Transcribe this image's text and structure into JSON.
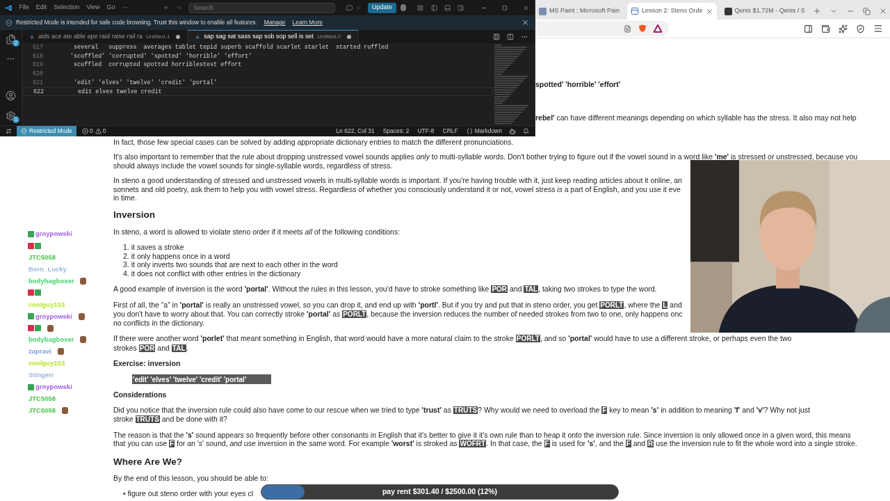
{
  "editor": {
    "menu": [
      "File",
      "Edit",
      "Selection",
      "View",
      "Go",
      "···"
    ],
    "search": {
      "placeholder": "Search"
    },
    "update_button": "Update",
    "banner": {
      "text": "Restricted Mode is intended for safe code browsing. Trust this window to enable all features.",
      "links": [
        "Manage",
        "Learn More"
      ]
    },
    "activity_badges": {
      "explorer": "2",
      "settings": "1"
    },
    "tabs": [
      {
        "label": "aids ace ate able ape raid raise rail ra",
        "file": "Untitled-1",
        "selected": false,
        "dirty": true
      },
      {
        "label": "sap sag sat sass sap sob sop sell is set",
        "file": "Untitled-2",
        "selected": true,
        "dirty": true
      }
    ],
    "lines": [
      {
        "number": "617",
        "text": "  several   suppress  averages tablet tepid superb scaffold scarlet starlet  started ruffled",
        "current": false
      },
      {
        "number": "618",
        "text": " 'scuffled' 'corrupted' 'spotted' 'horrible' 'effort'",
        "current": false
      },
      {
        "number": "619",
        "text": "  scuffled  corrupted spotted horriblestest effort",
        "current": false
      },
      {
        "number": "620",
        "current": false
      },
      {
        "number": "621",
        "text": "  'edit' 'elves' 'twelve' 'credit' 'portal'",
        "current": false
      },
      {
        "number": "622",
        "text": "   edit elves twelve credit",
        "current": true
      }
    ],
    "status_bar": {
      "mode": "Restricted Mode",
      "errors": "0",
      "warnings": "0",
      "items": [
        "Ln 622, Col 31",
        "Spaces: 2",
        "UTF-8",
        "CRLF"
      ],
      "language": "Markdown"
    }
  },
  "browser": {
    "tabs": [
      {
        "title": "MS Paint : Microsoft Pain",
        "selected": false,
        "closable": false
      },
      {
        "title": "Lesson 2: Steno Orde",
        "selected": true,
        "closable": true
      },
      {
        "title": "Qenis $1.72M - Qenis / S",
        "selected": false,
        "closable": false
      }
    ]
  },
  "article": [
    {
      "kind": "fragment",
      "bold": true,
      "lines": [
        [
          "spotted' 'horrible' 'effort'"
        ]
      ]
    },
    {
      "kind": "fragment",
      "bold": false,
      "lines": [
        [
          "**rebel'** can have different meanings depending on which syllable has the stress. It also may not help"
        ]
      ]
    },
    {
      "kind": "p",
      "lines": [
        [
          "In fact, those few special cases can be solved by adding appropriate dictionary entries to match the different pronunciations."
        ]
      ]
    },
    {
      "kind": "p",
      "lines": [
        [
          "It's also important to remember that the rule about dropping unstressed vowel sounds applies *only* to multi-syllable words. Don't bother trying to figure out if the vowel sound in a word like **'me'** is stressed or unstressed, because you"
        ],
        [
          "should always include the vowel sounds for single-syllable words, regardless of stress."
        ]
      ]
    },
    {
      "kind": "p",
      "lines": [
        [
          "In steno a good understanding of stressed and unstressed vowels in multi-syllable words is important. If you're having trouble with it, just keep reading articles about it online, an"
        ],
        [
          "sonnets and old poetry, ask them to help you with vowel stress. Regardless of whether you consciously understand it or not, vowel stress *is* a part of English, and you use it eve"
        ],
        [
          "in time."
        ]
      ]
    },
    {
      "kind": "h2",
      "text": "Inversion"
    },
    {
      "kind": "p",
      "lines": [
        [
          "In steno, a word is allowed to violate steno order if it meets *all* of the following conditions:"
        ]
      ]
    },
    {
      "kind": "list",
      "items": [
        {
          "marker": "1.",
          "text": "it saves a stroke"
        },
        {
          "marker": "2.",
          "text": "it only happens once in a word"
        },
        {
          "marker": "3.",
          "text": "it only inverts two sounds that are next to each other in the word"
        },
        {
          "marker": "4.",
          "text": "it does not conflict with other entries in the dictionary"
        }
      ]
    },
    {
      "kind": "p",
      "lines": [
        [
          "A good example of inversion is the word **'portal'**. Without the rules in this lesson, you'd have to stroke something like ",
          {
            "key": "POR"
          },
          " and ",
          {
            "key": "TAL"
          },
          ", taking two strokes to type the word."
        ]
      ]
    },
    {
      "kind": "p",
      "lines": [
        [
          "First of all, the “a” in **'portal'** is really an unstressed vowel, so you can drop it, and end up with **'portl'**. But if you try and put that in steno order, you get ",
          {
            "key": "PORLT"
          },
          ", where the ",
          {
            "key": "L"
          },
          " and"
        ],
        [
          "you don't have to worry about that. You can correctly stroke **'portal'** as ",
          {
            "key": "PORLT"
          },
          ", because the inversion reduces the number of needed strokes from two to one, only happens onc"
        ],
        [
          "no conflicts in the dictionary."
        ]
      ]
    },
    {
      "kind": "p",
      "lines": [
        [
          "If there were another word **'porlet'** that meant something in English, that word would have a more natural claim to the stroke ",
          {
            "key": "PORLT"
          },
          ", and so **'portal'** would have to use a different stroke, or perhaps even the two"
        ],
        [
          "strokes ",
          {
            "key": "POR"
          },
          " and ",
          {
            "key": "TAL"
          },
          "."
        ]
      ]
    },
    {
      "kind": "h3",
      "text": "Exercise: inversion"
    },
    {
      "kind": "field",
      "value": "'edit' 'elves' 'twelve' 'credit' 'portal'"
    },
    {
      "kind": "h3",
      "text": "Considerations"
    },
    {
      "kind": "p",
      "lines": [
        [
          "Did you notice that the inversion rule could also have come to our rescue when we tried to type **'trust'** as ",
          {
            "key": "TRUTS"
          },
          "? Why would we need to overload the ",
          {
            "key": "F"
          },
          " key to mean **'s'** in addition to meaning **'f'** and **'v'**? Why not just"
        ],
        [
          "stroke ",
          {
            "key": "TRUTS"
          },
          " and be done with it?"
        ]
      ]
    },
    {
      "kind": "p",
      "lines": [
        [
          "The reason is that the **'s'** sound appears so frequently before other consonants in English that it's better to give it it's own rule than to heap it onto the inversion rule. Since inversion is only allowed once in a given word, this means"
        ],
        [
          "that you can use ",
          {
            "key": "F"
          },
          " for an 's' sound, *and* use inversion in the same word. For example **'worst'** is stroked as ",
          {
            "key": "WOFRT"
          },
          ". In that case, the ",
          {
            "key": "F"
          },
          " is used for **'s'**, and the ",
          {
            "key": "F"
          },
          " and ",
          {
            "key": "R"
          },
          " use the inversion rule to fit the whole word into a single stroke."
        ]
      ]
    },
    {
      "kind": "h2",
      "text": "Where Are We?"
    },
    {
      "kind": "p",
      "lines": [
        [
          "By the end of this lesson, you should be able to:"
        ]
      ]
    },
    {
      "kind": "list",
      "items": [
        {
          "marker": "•",
          "text": "figure out steno order with your eyes cl"
        }
      ]
    }
  ],
  "chat": [
    {
      "name": "groypowski",
      "color": "#a35ee0",
      "badges": [
        {
          "kind": "sub"
        }
      ],
      "emote": false
    },
    {
      "badges": [
        {
          "kind": "gift"
        },
        {
          "kind": "sub"
        }
      ],
      "emote": false
    },
    {
      "name": "JTC5058",
      "color": "#45c445",
      "emote": false
    },
    {
      "name": "Born_Lucky",
      "color": "#9cb8de",
      "emote": false
    },
    {
      "name": "bodybagboxer",
      "color": "#40d46c",
      "emote": true
    },
    {
      "badges": [
        {
          "kind": "gift"
        },
        {
          "kind": "sub"
        }
      ],
      "emote": false
    },
    {
      "name": "coolguy103",
      "color": "#b4e41f",
      "emote": false
    },
    {
      "name": "groypowski",
      "color": "#a35ee0",
      "badges": [
        {
          "kind": "sub"
        }
      ],
      "emote": true
    },
    {
      "badges": [
        {
          "kind": "gift"
        },
        {
          "kind": "sub"
        }
      ],
      "emote": true
    },
    {
      "name": "bodybagboxer",
      "color": "#40d46c",
      "emote": true
    },
    {
      "name": "zapravi",
      "color": "#7f9fe0",
      "emote": true
    },
    {
      "name": "coolguy103",
      "color": "#b4e41f",
      "emote": false
    },
    {
      "name": "Stingerr",
      "color": "#9fb6d8",
      "emote": false
    },
    {
      "name": "groypowski",
      "color": "#a35ee0",
      "badges": [
        {
          "kind": "sub"
        }
      ],
      "emote": false
    },
    {
      "name": "JTC5058",
      "color": "#45c445",
      "emote": false
    },
    {
      "name": "JTC5058",
      "color": "#45c445",
      "emote": true
    }
  ],
  "goal": {
    "text": "pay rent $301.40 / $2500.00 (12%)",
    "level": 0.12
  }
}
